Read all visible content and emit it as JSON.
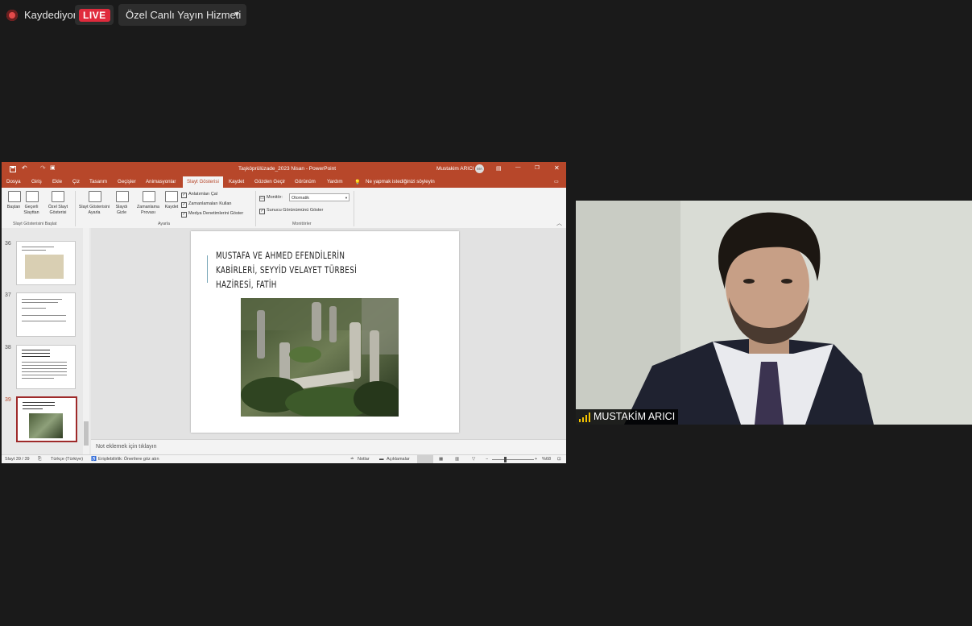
{
  "zoom_bar": {
    "recording_label": "Kaydediyor",
    "live_label": "LIVE",
    "service_label": "Özel Canlı Yayın Hizmeti"
  },
  "powerpoint": {
    "window_title": "Taşköprülüzade_2023 Nisan  -  PowerPoint",
    "user_name": "Mustakim ARICI",
    "user_initials": "MA",
    "tabs": [
      "Dosya",
      "Giriş",
      "Ekle",
      "Çiz",
      "Tasarım",
      "Geçişler",
      "Animasyonlar",
      "Slayt Gösterisi",
      "Kaydet",
      "Gözden Geçir",
      "Görünüm",
      "Yardım"
    ],
    "tell_me": "Ne yapmak istediğinizi söyleyin",
    "ribbon": {
      "from_beginning": "Baştan",
      "from_current": [
        "Geçerli",
        "Slayttan"
      ],
      "custom_show": [
        "Özel Slayt",
        "Gösterisi"
      ],
      "group_start": "Slayt Gösterisini Başlat",
      "setup_show": [
        "Slayt Gösterisini",
        "Ayarla"
      ],
      "hide_slide": [
        "Slaydı",
        "Gizle"
      ],
      "rehearse": [
        "Zamanlama",
        "Provası"
      ],
      "record": "Kaydet",
      "group_setup": "Ayarla",
      "check_narrations": "Anlatımları Çal",
      "check_timings": "Zamanlamaları Kullan",
      "check_media": "Medya Denetimlerini Göster",
      "monitor_label": "Monitör:",
      "monitor_value": "Otomatik",
      "presenter_view": "Sunucu Görünümünü Göster",
      "group_monitors": "Monitörler"
    },
    "thumbnails": [
      {
        "number": "36"
      },
      {
        "number": "37"
      },
      {
        "number": "38"
      },
      {
        "number": "39",
        "selected": true
      }
    ],
    "slide": {
      "title_lines": [
        "MUSTAFA VE AHMED EFENDİLERİN",
        "KABİRLERİ, SEYYİD VELAYET TÜRBESİ",
        "HAZİRESİ, FATİH"
      ]
    },
    "notes_placeholder": "Not eklemek için tıklayın",
    "status": {
      "slide_counter": "Slayt 39 / 39",
      "language": "Türkçe (Türkiye)",
      "accessibility": "Erişilebilirlik: Önerilere göz atın",
      "notes": "Notlar",
      "comments": "Açıklamalar",
      "zoom": "%68"
    }
  },
  "video": {
    "participant_name": "MUSTAKİM ARICI"
  }
}
